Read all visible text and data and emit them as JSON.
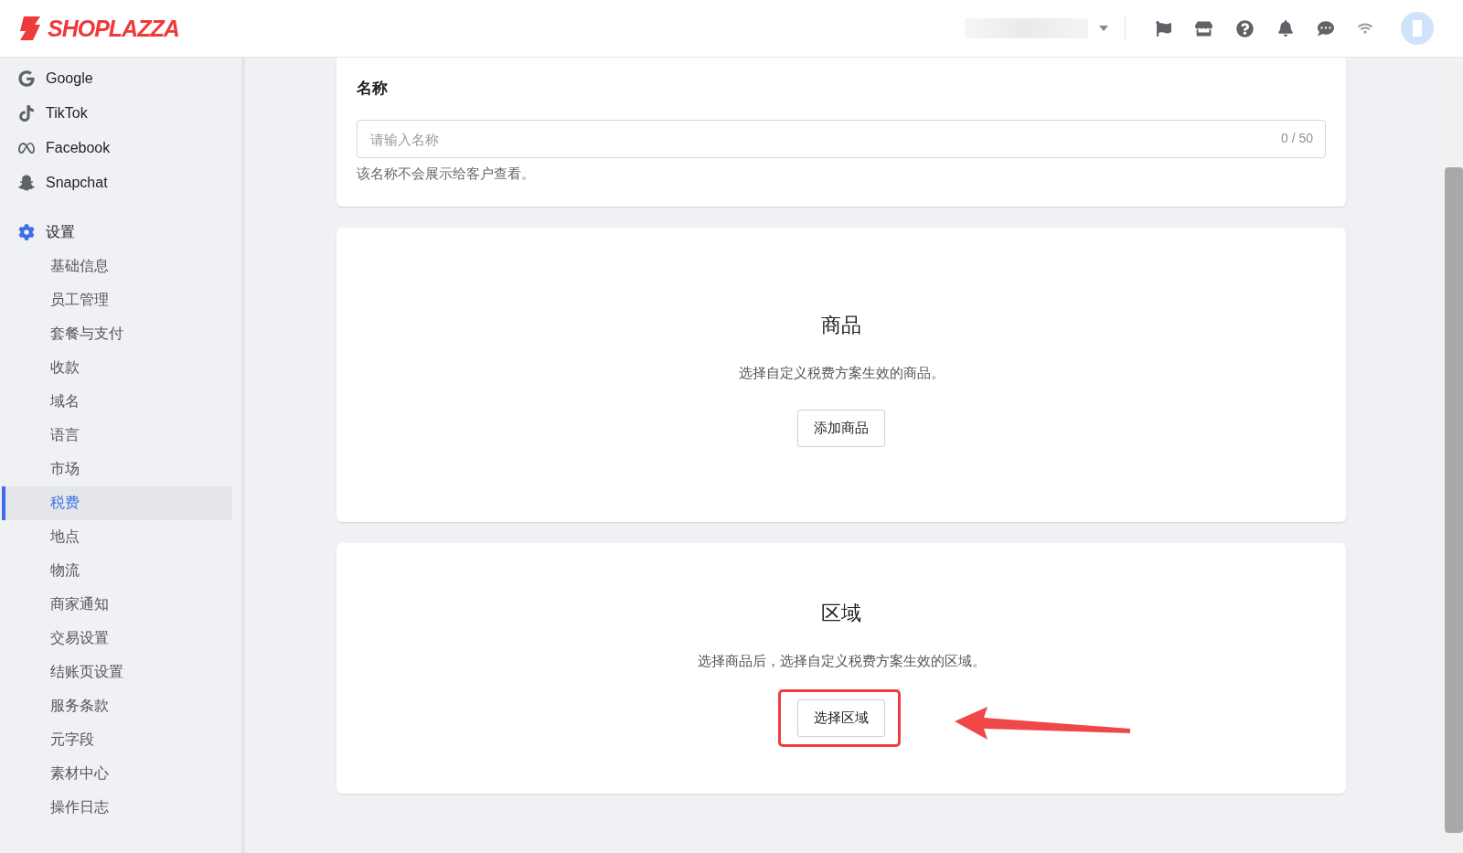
{
  "header": {
    "logo": "SHOPLAZZA"
  },
  "sidebar": {
    "channels": [
      {
        "label": "Google",
        "kind": "google"
      },
      {
        "label": "TikTok",
        "kind": "tiktok"
      },
      {
        "label": "Facebook",
        "kind": "meta"
      },
      {
        "label": "Snapchat",
        "kind": "snapchat"
      }
    ],
    "settings": {
      "label": "设置",
      "children": [
        {
          "label": "基础信息",
          "selected": false
        },
        {
          "label": "员工管理",
          "selected": false
        },
        {
          "label": "套餐与支付",
          "selected": false
        },
        {
          "label": "收款",
          "selected": false
        },
        {
          "label": "域名",
          "selected": false
        },
        {
          "label": "语言",
          "selected": false
        },
        {
          "label": "市场",
          "selected": false
        },
        {
          "label": "税费",
          "selected": true
        },
        {
          "label": "地点",
          "selected": false
        },
        {
          "label": "物流",
          "selected": false
        },
        {
          "label": "商家通知",
          "selected": false
        },
        {
          "label": "交易设置",
          "selected": false
        },
        {
          "label": "结账页设置",
          "selected": false
        },
        {
          "label": "服务条款",
          "selected": false
        },
        {
          "label": "元字段",
          "selected": false
        },
        {
          "label": "素材中心",
          "selected": false
        },
        {
          "label": "操作日志",
          "selected": false
        }
      ]
    }
  },
  "name_card": {
    "title": "名称",
    "placeholder": "请输入名称",
    "counter": "0 / 50",
    "help": "该名称不会展示给客户查看。"
  },
  "sections": [
    {
      "title": "商品",
      "description": "选择自定义税费方案生效的商品。",
      "button": "添加商品",
      "highlighted": false
    },
    {
      "title": "区域",
      "description": "选择商品后，选择自定义税费方案生效的区域。",
      "button": "选择区域",
      "highlighted": true
    }
  ]
}
